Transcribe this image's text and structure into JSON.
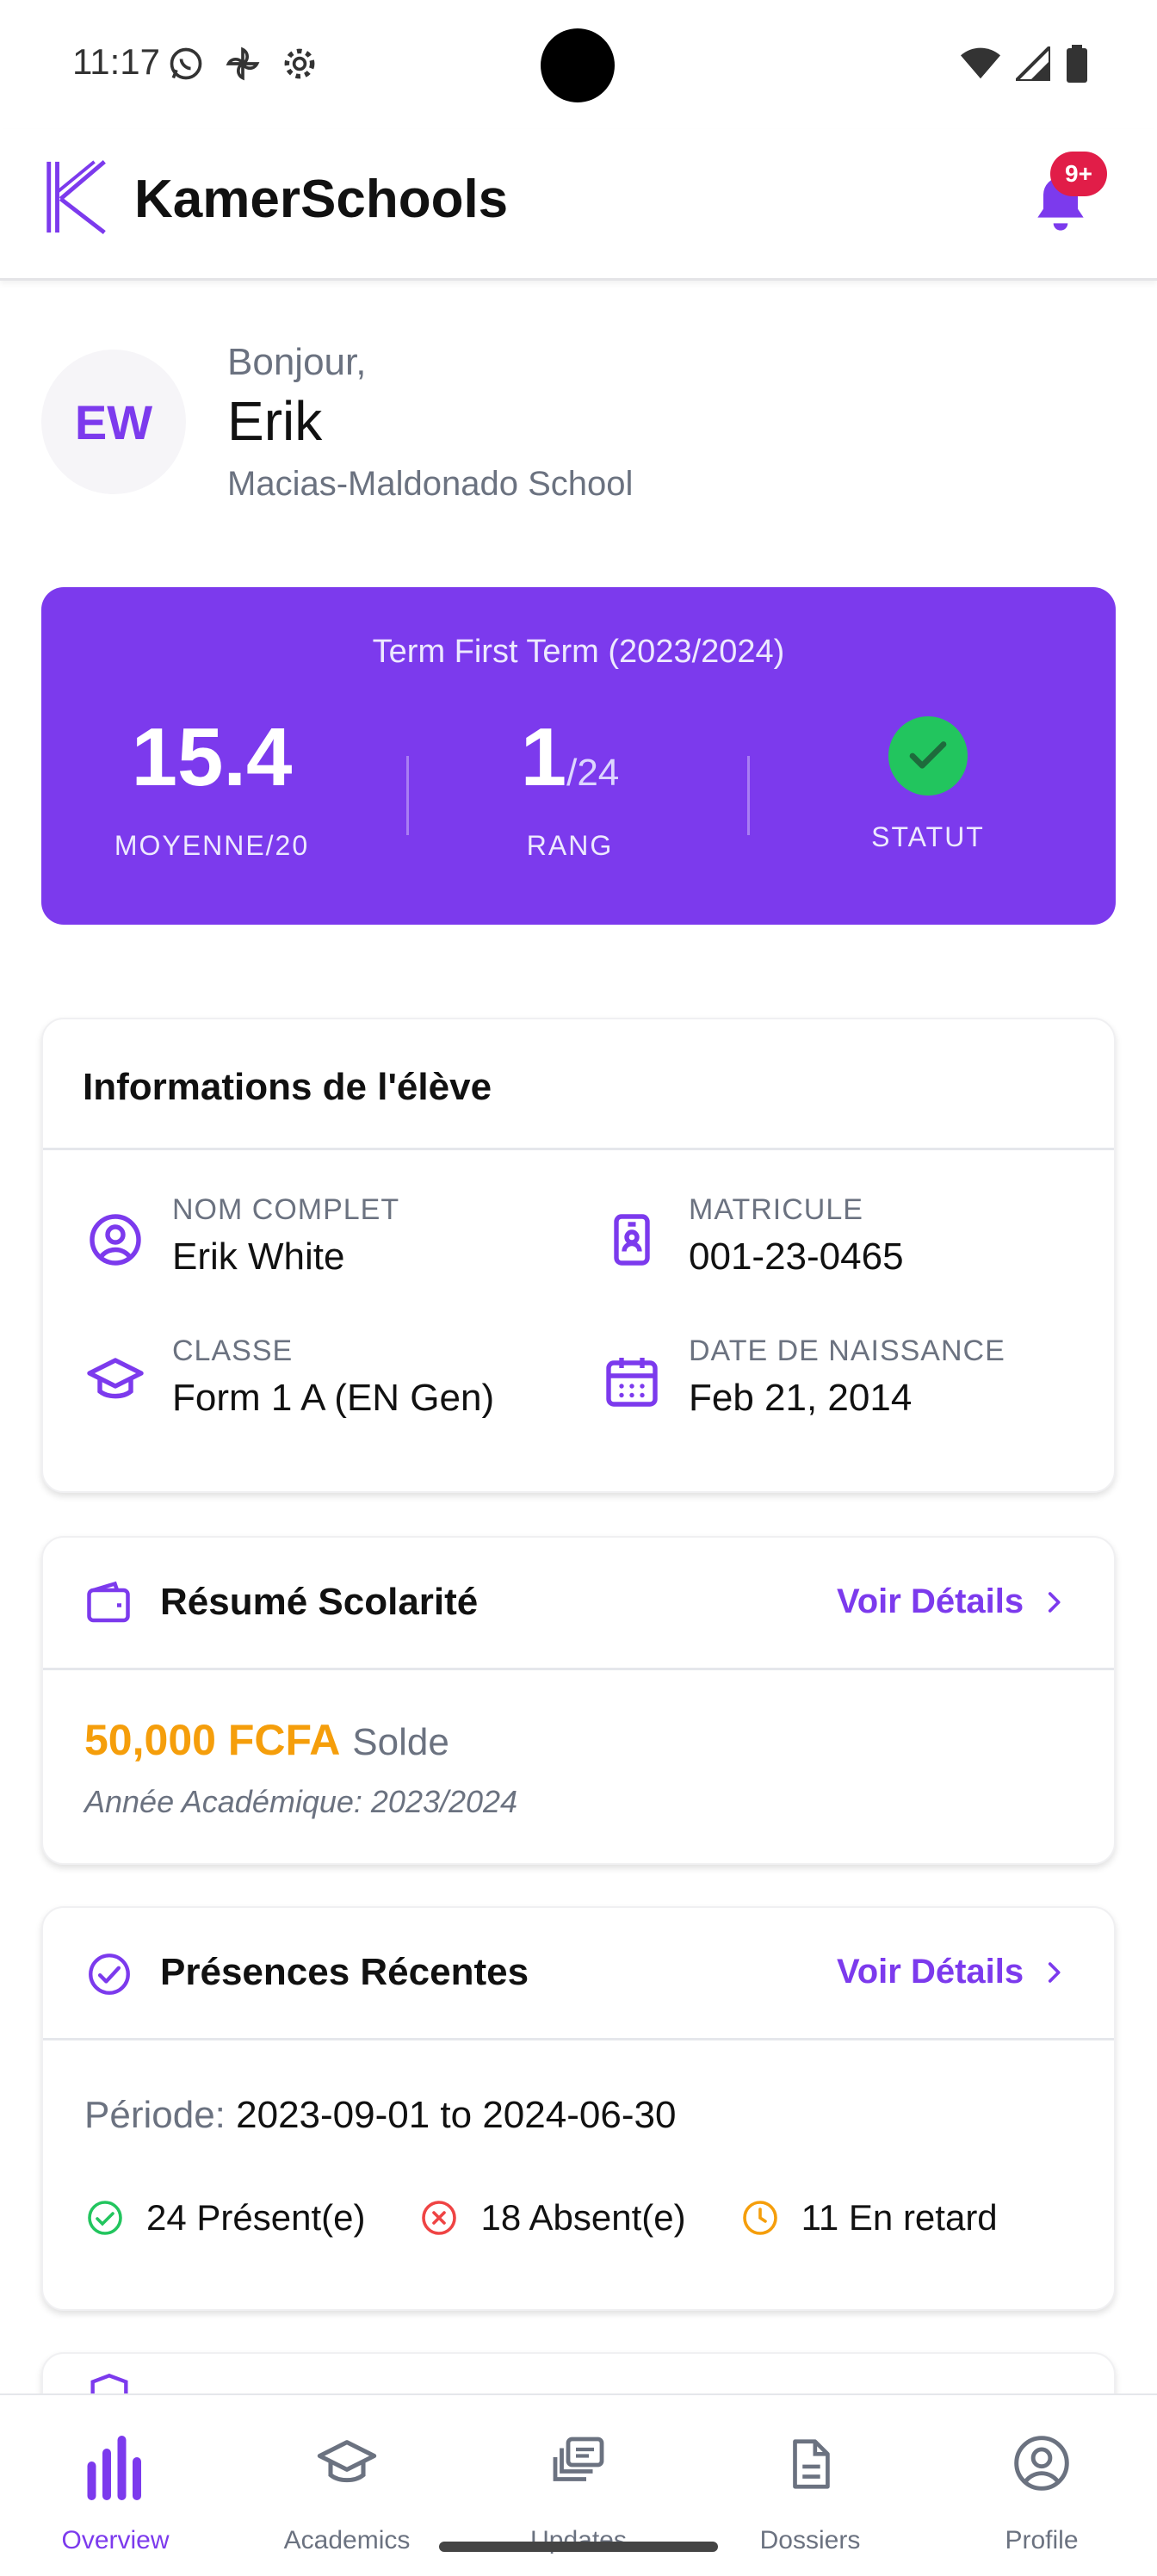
{
  "status_bar": {
    "time": "11:17",
    "left_icons": [
      "whatsapp-icon",
      "pinwheel-icon",
      "settings-icon"
    ],
    "right_icons": [
      "wifi-icon",
      "signal-icon",
      "battery-icon"
    ]
  },
  "header": {
    "brand": "KamerSchools",
    "notification_badge": "9+"
  },
  "greeting": {
    "avatar_initials": "EW",
    "hello": "Bonjour,",
    "name": "Erik",
    "school": "Macias-Maldonado School"
  },
  "term_card": {
    "title": "Term First Term (2023/2024)",
    "average": "15.4",
    "average_label": "MOYENNE/20",
    "rank": "1",
    "rank_total": "/24",
    "rank_label": "RANG",
    "status_label": "STATUT"
  },
  "student_info": {
    "title": "Informations de l'élève",
    "full_name_label": "NOM COMPLET",
    "full_name": "Erik White",
    "matricule_label": "MATRICULE",
    "matricule": "001-23-0465",
    "class_label": "CLASSE",
    "class": "Form 1 A (EN Gen)",
    "birth_label": "DATE DE NAISSANCE",
    "birth": "Feb 21, 2014"
  },
  "fees": {
    "title": "Résumé Scolarité",
    "details_link": "Voir Détails",
    "amount": "50,000 FCFA",
    "amount_label": "Solde",
    "academic_year": "Année Académique: 2023/2024"
  },
  "attendance": {
    "title": "Présences Récentes",
    "details_link": "Voir Détails",
    "period_label": "Période:",
    "period": "2023-09-01 to 2024-06-30",
    "present": "24 Présent(e)",
    "absent": "18 Absent(e)",
    "late": "11 En retard"
  },
  "bottom_nav": {
    "items": [
      {
        "label": "Overview",
        "icon": "bar-chart-icon",
        "active": true
      },
      {
        "label": "Academics",
        "icon": "graduation-cap-icon",
        "active": false
      },
      {
        "label": "Updates",
        "icon": "stacked-updates-icon",
        "active": false
      },
      {
        "label": "Dossiers",
        "icon": "document-icon",
        "active": false
      },
      {
        "label": "Profile",
        "icon": "user-circle-icon",
        "active": false
      }
    ]
  },
  "colors": {
    "accent": "#7c3aed",
    "amount": "#f59e0b",
    "present": "#22c55e",
    "absent": "#ef4444",
    "late": "#f59e0b",
    "badge": "#e11d48"
  }
}
